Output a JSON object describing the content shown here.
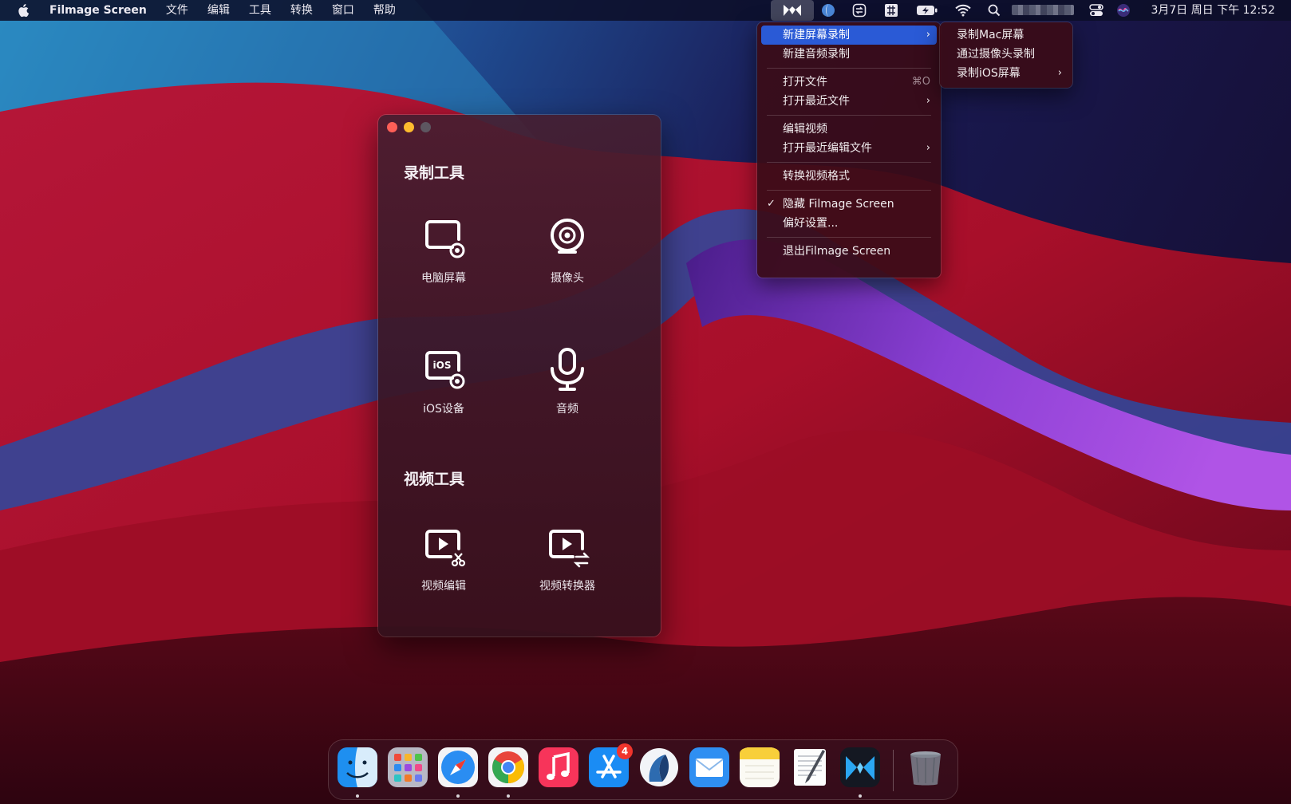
{
  "menubar": {
    "app_name": "Filmage Screen",
    "menus": [
      "文件",
      "编辑",
      "工具",
      "转换",
      "窗口",
      "帮助"
    ],
    "clock": "3月7日 周日 下午 12:52"
  },
  "window": {
    "sections": [
      {
        "title": "录制工具",
        "tools": [
          {
            "label": "电脑屏幕",
            "icon": "screen-record-icon"
          },
          {
            "label": "摄像头",
            "icon": "webcam-icon"
          },
          {
            "label": "iOS设备",
            "icon": "ios-device-icon"
          },
          {
            "label": "音频",
            "icon": "microphone-icon"
          }
        ]
      },
      {
        "title": "视频工具",
        "tools": [
          {
            "label": "视频编辑",
            "icon": "video-edit-icon"
          },
          {
            "label": "视频转换器",
            "icon": "video-convert-icon"
          }
        ]
      }
    ],
    "ios_icon_text": "iOS"
  },
  "dropdown": {
    "items": [
      {
        "label": "新建屏幕录制",
        "submenu": true,
        "selected": true
      },
      {
        "label": "新建音频录制"
      },
      {
        "label": "打开文件",
        "shortcut": "⌘O"
      },
      {
        "label": "打开最近文件",
        "submenu": true
      },
      {
        "label": "编辑视频"
      },
      {
        "label": "打开最近编辑文件",
        "submenu": true
      },
      {
        "label": "转换视频格式"
      },
      {
        "label": "隐藏 Filmage Screen",
        "checked": true
      },
      {
        "label": "偏好设置..."
      },
      {
        "label": "退出Filmage Screen"
      }
    ],
    "check_mark": "✓",
    "arrow": "›"
  },
  "submenu": {
    "items": [
      {
        "label": "录制Mac屏幕"
      },
      {
        "label": "通过摄像头录制"
      },
      {
        "label": "录制iOS屏幕",
        "submenu": true
      }
    ]
  },
  "dock": {
    "apps": [
      "finder-icon",
      "launchpad-icon",
      "safari-icon",
      "chrome-icon",
      "music-icon",
      "app-store-icon",
      "dictionary-app-icon",
      "mail-icon",
      "notes-icon",
      "textedit-icon",
      "filmage-screen-icon",
      "trash-icon"
    ],
    "app_store_badge": "4"
  },
  "colors": {
    "menu_highlight": "#2a5ad6",
    "close": "#fe5f57",
    "minimize": "#febc2e",
    "badge": "#f0342c"
  }
}
